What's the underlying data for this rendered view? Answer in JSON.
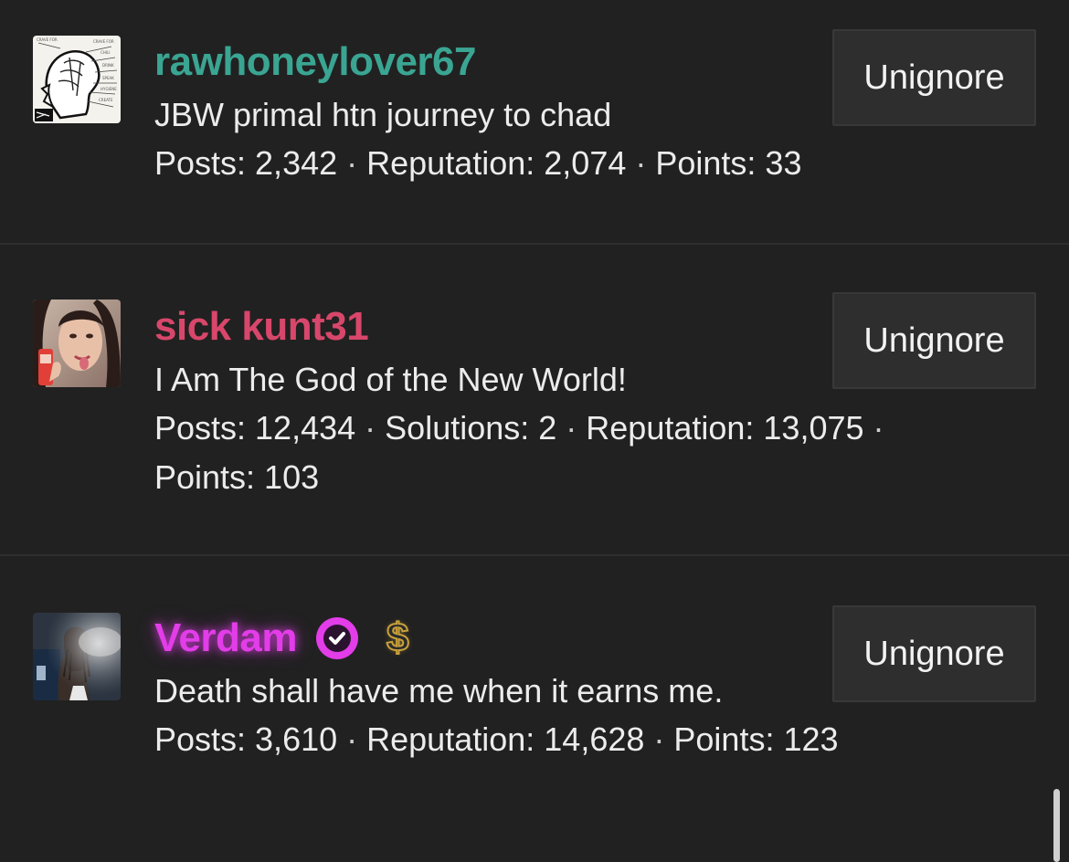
{
  "users": [
    {
      "username": "rawhoneylover67",
      "username_color": "#3aa592",
      "signature": "JBW primal htn journey to chad",
      "stats": [
        "Posts: 2,342",
        "Reputation: 2,074",
        "Points: 33"
      ],
      "button_label": "Unignore",
      "avatar_icon": "brain-diagram-sketch"
    },
    {
      "username": "sick kunt31",
      "username_color": "#d8476b",
      "signature": "I Am The God of the New World!",
      "stats": [
        "Posts: 12,434",
        "Solutions: 2",
        "Reputation: 13,075",
        "Points: 103"
      ],
      "button_label": "Unignore",
      "avatar_icon": "portrait-photo"
    },
    {
      "username": "Verdam",
      "username_color": "#e23de8",
      "verified": true,
      "badge_icons": [
        "verified-check-icon",
        "dollar-icon"
      ],
      "badge_dollar": "$",
      "signature": "Death shall have me when it earns me.",
      "stats": [
        "Posts: 3,610",
        "Reputation: 14,628",
        "Points: 123"
      ],
      "button_label": "Unignore",
      "avatar_icon": "smoke-photo"
    }
  ],
  "separator": "·",
  "colors": {
    "background": "#212121",
    "button_background": "#2e2e2e",
    "divider": "#2e2e2e",
    "text": "#ececec"
  }
}
